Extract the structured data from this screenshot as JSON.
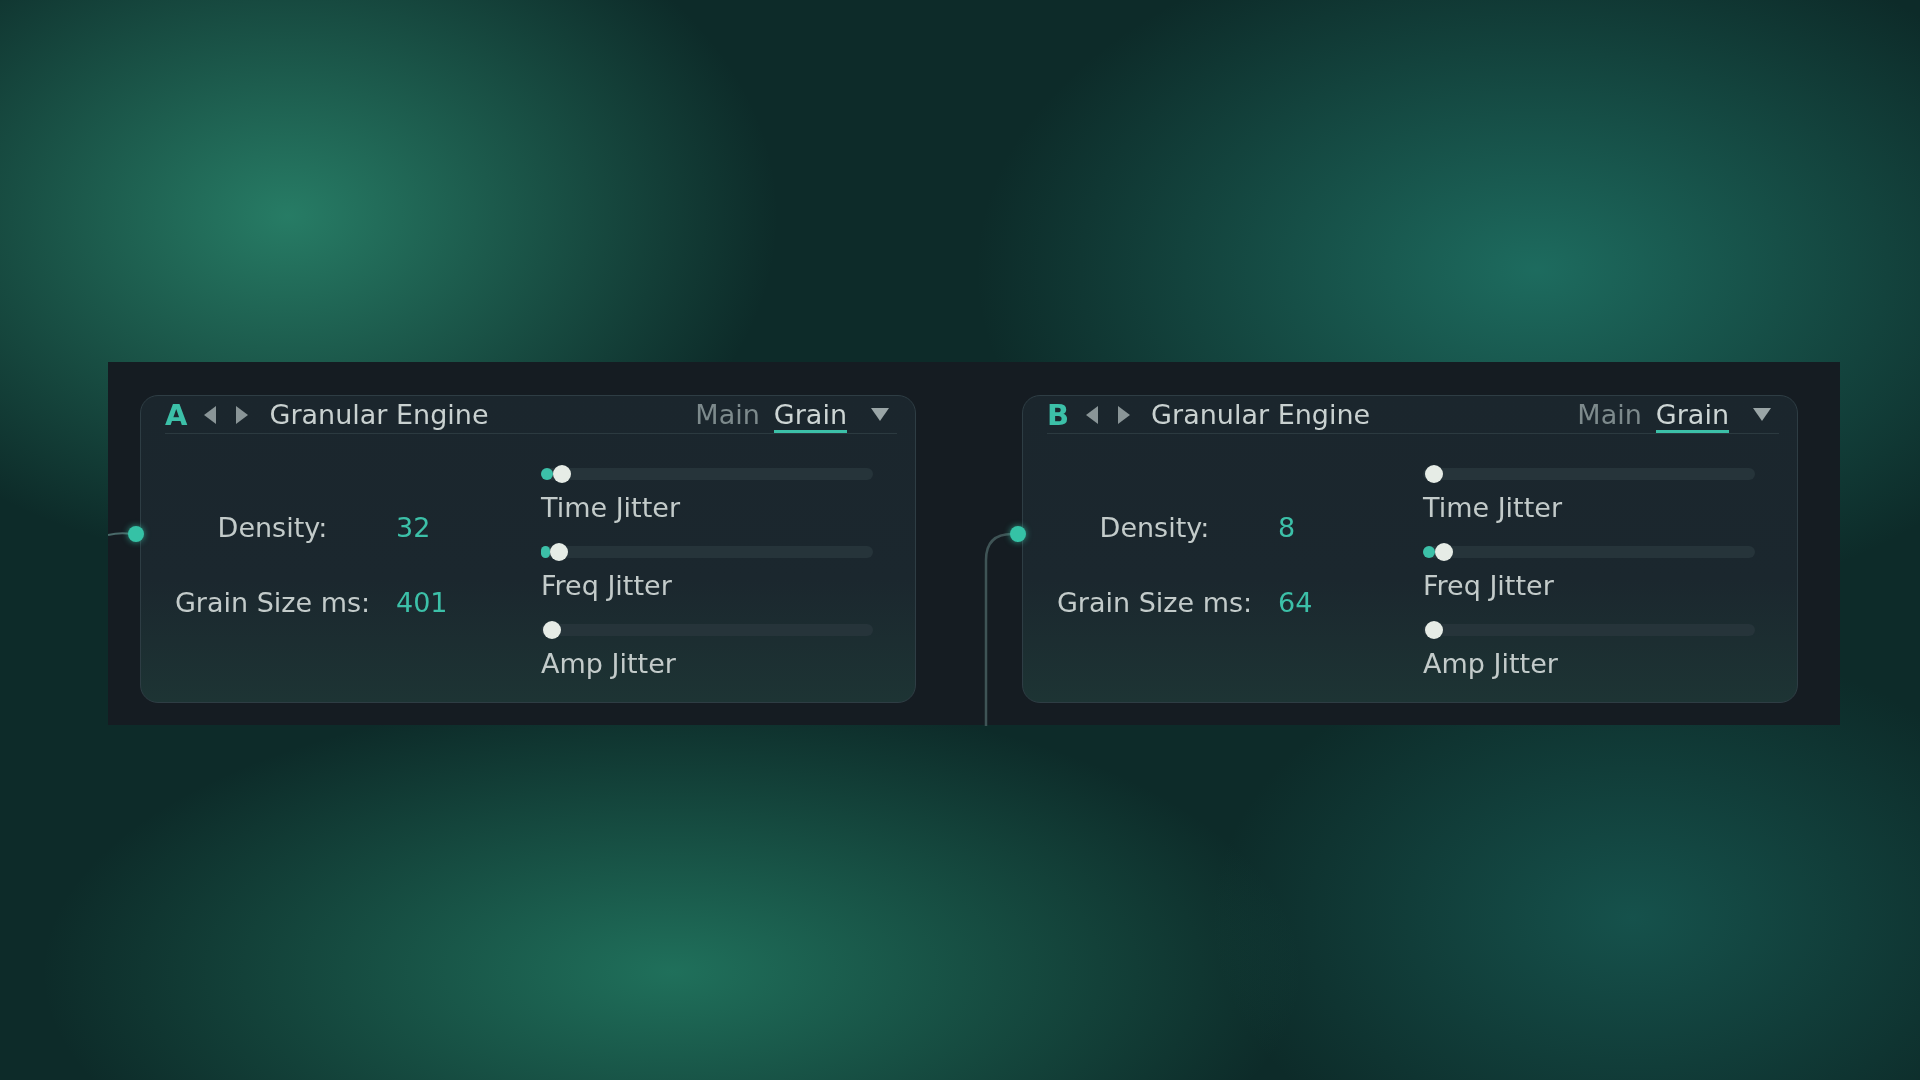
{
  "modules": [
    {
      "letter": "A",
      "title": "Granular Engine",
      "tabs": [
        {
          "label": "Main",
          "selected": false
        },
        {
          "label": "Grain",
          "selected": true
        }
      ],
      "params": [
        {
          "label": "Density:",
          "value": "32"
        },
        {
          "label": "Grain Size ms:",
          "value": "401"
        }
      ],
      "sliders": [
        {
          "name": "Time Jitter",
          "level": 0.03
        },
        {
          "name": "Freq Jitter",
          "level": 0.02
        },
        {
          "name": "Amp Jitter",
          "level": 0
        }
      ]
    },
    {
      "letter": "B",
      "title": "Granular Engine",
      "tabs": [
        {
          "label": "Main",
          "selected": false
        },
        {
          "label": "Grain",
          "selected": true
        }
      ],
      "params": [
        {
          "label": "Density:",
          "value": "8"
        },
        {
          "label": "Grain Size ms:",
          "value": "64"
        }
      ],
      "sliders": [
        {
          "name": "Time Jitter",
          "level": 0
        },
        {
          "name": "Freq Jitter",
          "level": 0.03
        },
        {
          "name": "Amp Jitter",
          "level": 0
        }
      ]
    }
  ]
}
